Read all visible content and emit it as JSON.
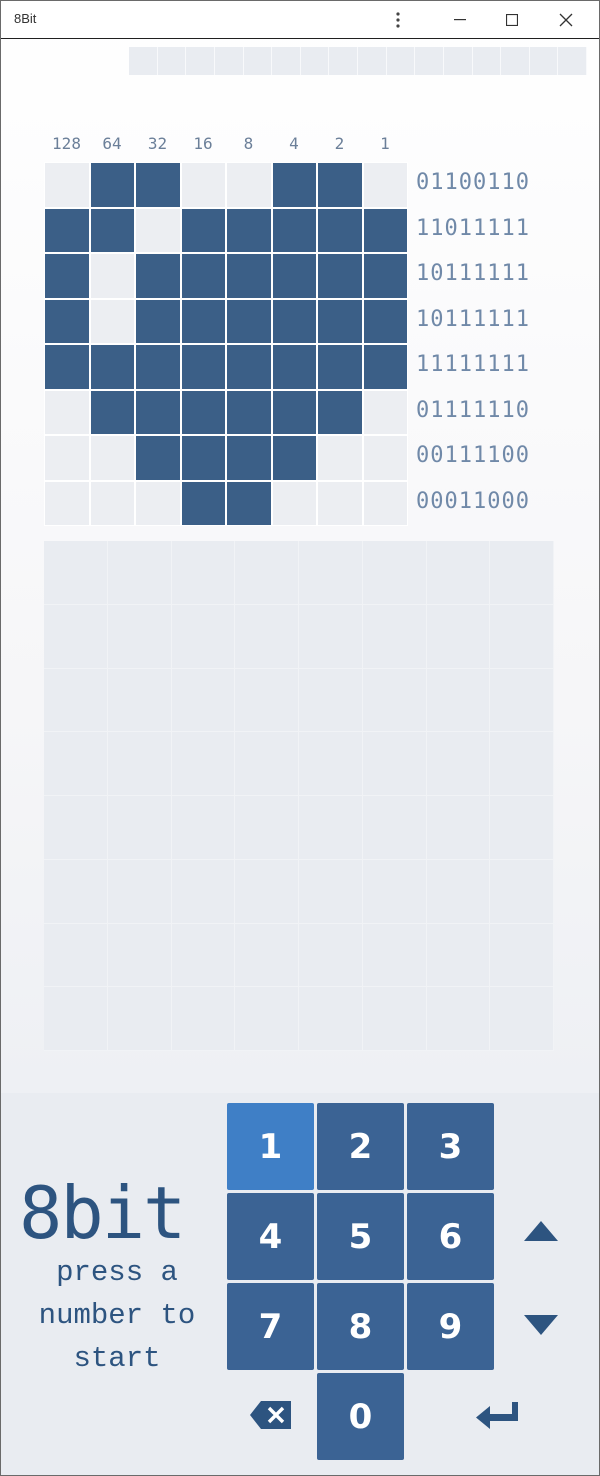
{
  "window": {
    "title": "8Bit"
  },
  "column_headers": [
    "128",
    "64",
    "32",
    "16",
    "8",
    "4",
    "2",
    "1"
  ],
  "pattern": [
    [
      0,
      1,
      1,
      0,
      0,
      1,
      1,
      0
    ],
    [
      1,
      1,
      0,
      1,
      1,
      1,
      1,
      1
    ],
    [
      1,
      0,
      1,
      1,
      1,
      1,
      1,
      1
    ],
    [
      1,
      0,
      1,
      1,
      1,
      1,
      1,
      1
    ],
    [
      1,
      1,
      1,
      1,
      1,
      1,
      1,
      1
    ],
    [
      0,
      1,
      1,
      1,
      1,
      1,
      1,
      0
    ],
    [
      0,
      0,
      1,
      1,
      1,
      1,
      0,
      0
    ],
    [
      0,
      0,
      0,
      1,
      1,
      0,
      0,
      0
    ]
  ],
  "row_labels": [
    "01100110",
    "11011111",
    "10111111",
    "10111111",
    "11111111",
    "01111110",
    "00111100",
    "00011000"
  ],
  "logo": "8bit",
  "message_lines": [
    "press a",
    "number to",
    "start"
  ],
  "keypad": {
    "keys": [
      "1",
      "2",
      "3",
      "4",
      "5",
      "6",
      "7",
      "8",
      "9",
      "0"
    ],
    "active_key": "1"
  },
  "colors": {
    "filled": "#3b5f87",
    "empty": "#eceef2",
    "key": "#3b6394",
    "key_active": "#3f7fc6",
    "label": "#7089a8"
  }
}
